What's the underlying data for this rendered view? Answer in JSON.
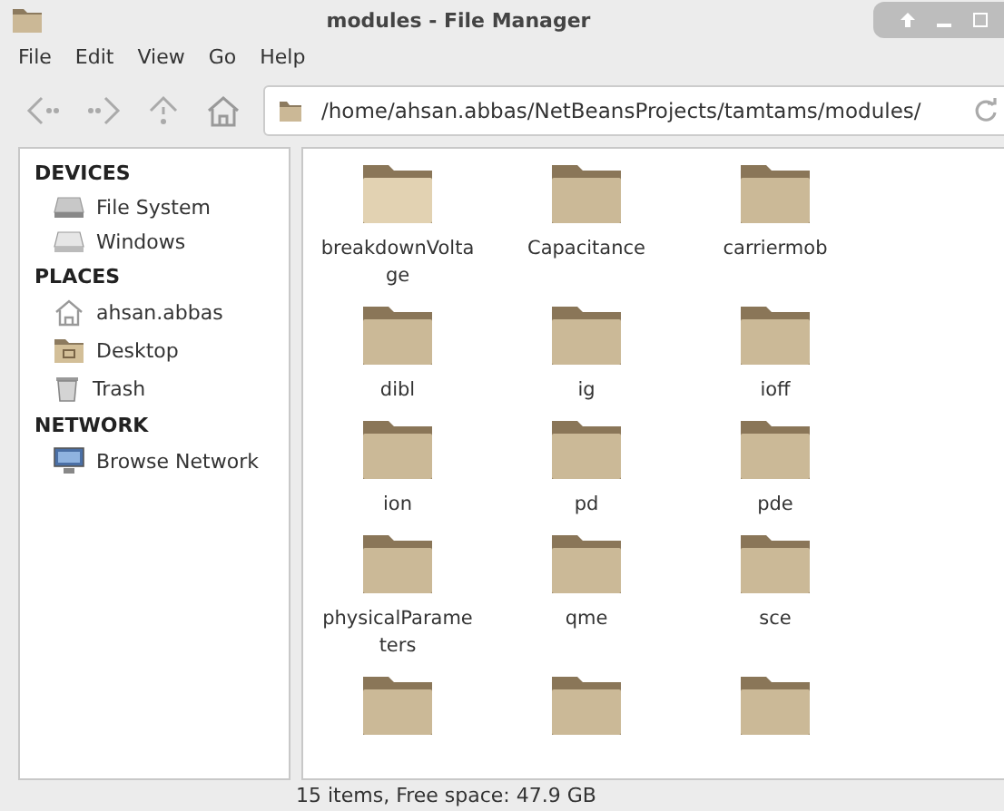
{
  "window": {
    "title": "modules - File Manager"
  },
  "menu": [
    "File",
    "Edit",
    "View",
    "Go",
    "Help"
  ],
  "location": {
    "path": "/home/ahsan.abbas/NetBeansProjects/tamtams/modules/"
  },
  "sidebar": [
    {
      "heading": "DEVICES",
      "items": [
        {
          "label": "File System",
          "kind": "drive"
        },
        {
          "label": "Windows",
          "kind": "drive-light"
        }
      ]
    },
    {
      "heading": "PLACES",
      "items": [
        {
          "label": "ahsan.abbas",
          "kind": "home"
        },
        {
          "label": "Desktop",
          "kind": "desktop"
        },
        {
          "label": "Trash",
          "kind": "trash"
        }
      ]
    },
    {
      "heading": "NETWORK",
      "items": [
        {
          "label": "Browse Network",
          "kind": "network"
        }
      ]
    }
  ],
  "items": [
    {
      "name": "breakdownVoltage",
      "kind": "folder"
    },
    {
      "name": "Capacitance",
      "kind": "folder"
    },
    {
      "name": "carriermob",
      "kind": "folder"
    },
    {
      "name": "dibl",
      "kind": "folder"
    },
    {
      "name": "ig",
      "kind": "folder"
    },
    {
      "name": "ioff",
      "kind": "folder"
    },
    {
      "name": "ion",
      "kind": "folder"
    },
    {
      "name": "pd",
      "kind": "folder"
    },
    {
      "name": "pde",
      "kind": "folder"
    },
    {
      "name": "physicalParameters",
      "kind": "folder"
    },
    {
      "name": "qme",
      "kind": "folder"
    },
    {
      "name": "sce",
      "kind": "folder"
    },
    {
      "kind": "folder"
    },
    {
      "kind": "folder"
    },
    {
      "kind": "folder"
    }
  ],
  "status_bar": "15 items, Free space: 47.9 GB"
}
